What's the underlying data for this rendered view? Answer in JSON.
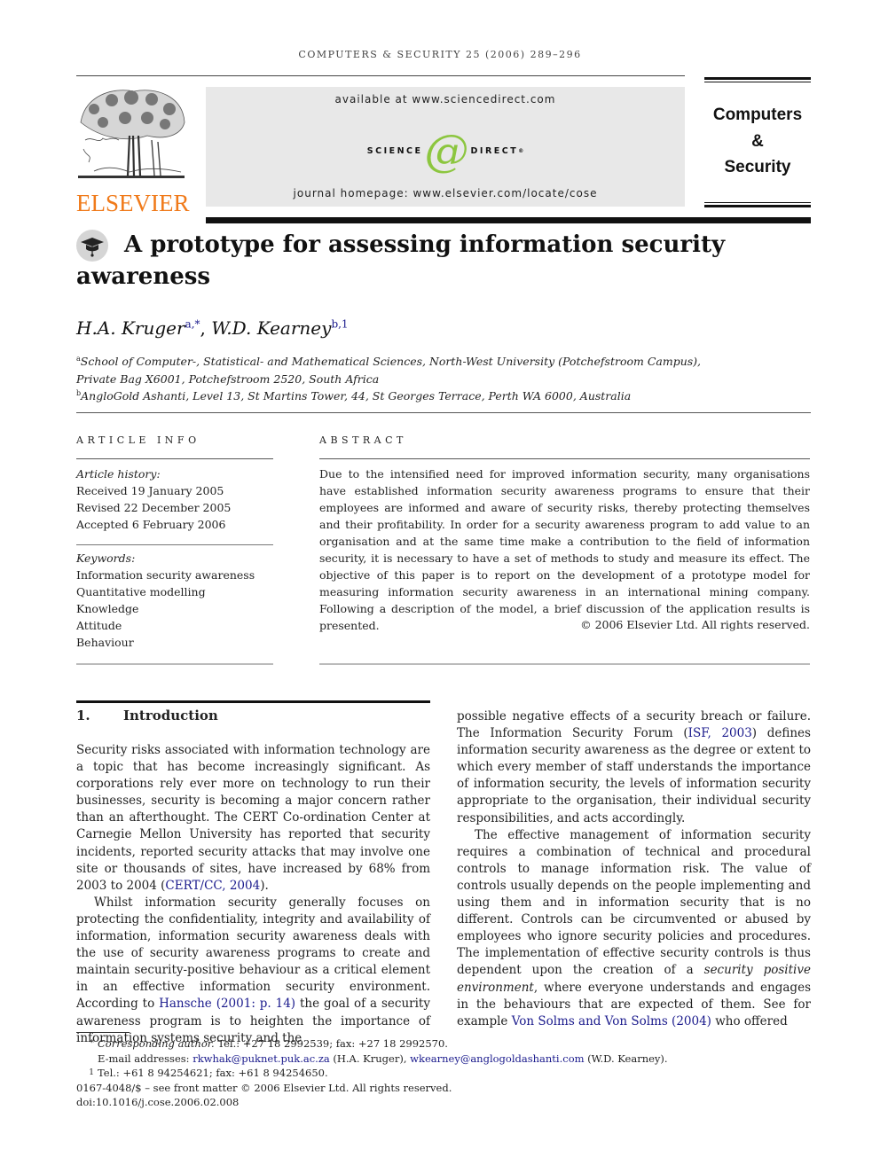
{
  "running_head": "COMPUTERS & SECURITY 25 (2006) 289–296",
  "banner": {
    "available": "available at www.sciencedirect.com",
    "logo_left": "SCIENCE",
    "logo_at": "d",
    "logo_right": "DIRECT",
    "logo_reg": "®",
    "homepage": "journal homepage: www.elsevier.com/locate/cose",
    "accent_color": "#8cc63f"
  },
  "publisher": {
    "name": "ELSEVIER",
    "color": "#f07a1a",
    "logo_icon": "tree-icon"
  },
  "journal": {
    "line1": "Computers",
    "line2": "&",
    "line3": "Security"
  },
  "article": {
    "title": "A prototype for assessing information security awareness",
    "title_icon": "graduation-cap-icon",
    "authors": [
      {
        "name": "H.A. Kruger",
        "marks": "a,*"
      },
      {
        "name": "W.D. Kearney",
        "marks": "b,1"
      }
    ],
    "affiliations": [
      {
        "mark": "a",
        "line1": "School of Computer-, Statistical- and Mathematical Sciences, North-West University (Potchefstroom Campus),",
        "line2": "Private Bag X6001, Potchefstroom 2520, South Africa"
      },
      {
        "mark": "b",
        "line1": "AngloGold Ashanti, Level 13, St Martins Tower, 44, St Georges Terrace, Perth WA 6000, Australia"
      }
    ]
  },
  "article_info": {
    "heading": "ARTICLE INFO",
    "history_label": "Article history:",
    "history": [
      "Received 19 January 2005",
      "Revised 22 December 2005",
      "Accepted 6 February 2006"
    ],
    "keywords_label": "Keywords:",
    "keywords": [
      "Information security awareness",
      "Quantitative modelling",
      "Knowledge",
      "Attitude",
      "Behaviour"
    ]
  },
  "abstract": {
    "heading": "ABSTRACT",
    "text": "Due to the intensified need for improved information security, many organisations have established information security awareness programs to ensure that their employees are informed and aware of security risks, thereby protecting themselves and their profitability. In order for a security awareness program to add value to an organisation and at the same time make a contribution to the field of information security, it is necessary to have a set of methods to study and measure its effect. The objective of this paper is to report on the development of a prototype model for measuring information security awareness in an international mining company. Following a description of the model, a brief discussion of the application results is presented.",
    "copyright": "© 2006 Elsevier Ltd. All rights reserved."
  },
  "section": {
    "number": "1.",
    "title": "Introduction"
  },
  "body": {
    "left_p1_pre": "Security risks associated with information technology are a topic that has become increasingly significant. As corporations rely ever more on technology to run their businesses, security is becoming a major concern rather than an afterthought. The CERT Co-ordination Center at Carnegie Mellon University has reported that security incidents, reported security attacks that may involve one site or thousands of sites, have increased by 68% from 2003 to 2004 (",
    "left_p1_link": "CERT/CC, 2004",
    "left_p1_post": ").",
    "left_p2_pre": "Whilst information security generally focuses on protecting the confidentiality, integrity and availability of information, information security awareness deals with the use of security awareness programs to create and maintain security-positive behaviour as a critical element in an effective information security environment. According to ",
    "left_p2_link": "Hansche (2001: p. 14)",
    "left_p2_post": " the goal of a security awareness program is to heighten the importance of information systems security and the",
    "right_p1_pre": "possible negative effects of a security breach or failure. The Information Security Forum (",
    "right_p1_link": "ISF, 2003",
    "right_p1_post": ") defines information security awareness as the degree or extent to which every member of staff understands the importance of information security, the levels of information security appropriate to the organisation, their individual security responsibilities, and acts accordingly.",
    "right_p2_pre": "The effective management of information security requires a combination of technical and procedural controls to manage information risk. The value of controls usually depends on the people implementing and using them and in information security that is no different. Controls can be circumvented or abused by employees who ignore security policies and procedures. The implementation of effective security controls is thus dependent upon the creation of a ",
    "right_p2_em": "security positive environment",
    "right_p2_mid": ", where everyone understands and engages in the behaviours that are expected of them. See for example ",
    "right_p2_link": "Von Solms and Von Solms (2004)",
    "right_p2_post": " who offered"
  },
  "footnotes": {
    "corr_mark": "*",
    "corr_label": "Corresponding author.",
    "corr_text": " Tel.: +27 18 2992539; fax: +27 18 2992570.",
    "email_label": "E-mail addresses: ",
    "email1": "rkwhak@puknet.puk.ac.za",
    "email1_who": " (H.A. Kruger), ",
    "email2": "wkearney@anglogoldashanti.com",
    "email2_who": " (W.D. Kearney).",
    "fn1_mark": "1",
    "fn1_text": "Tel.: +61 8 94254621; fax: +61 8 94254650.",
    "front_matter": "0167-4048/$ – see front matter © 2006 Elsevier Ltd. All rights reserved.",
    "doi": "doi:10.1016/j.cose.2006.02.008"
  }
}
